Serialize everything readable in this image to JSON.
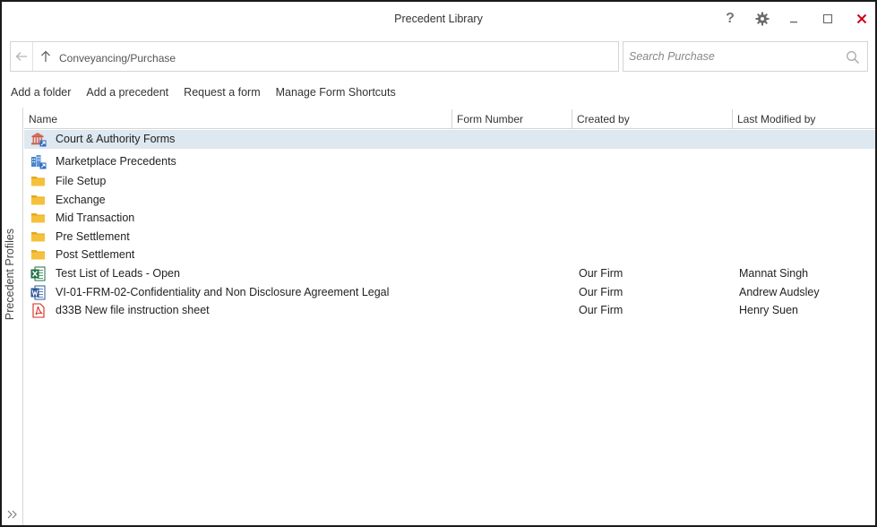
{
  "window": {
    "title": "Precedent Library"
  },
  "titlebar": {
    "help_label": "?"
  },
  "navigation": {
    "path": "Conveyancing/Purchase"
  },
  "search": {
    "placeholder": "Search Purchase"
  },
  "actions": [
    {
      "label": "Add a folder"
    },
    {
      "label": "Add a precedent"
    },
    {
      "label": "Request a form"
    },
    {
      "label": "Manage Form Shortcuts"
    }
  ],
  "sidebar": {
    "label": "Precedent Profiles"
  },
  "columns": {
    "name": "Name",
    "form_number": "Form Number",
    "created_by": "Created by",
    "last_modified_by": "Last Modified by"
  },
  "items": [
    {
      "name": "Court & Authority Forms",
      "icon": "court-building-shortcut-icon",
      "form_number": "",
      "created_by": "",
      "last_modified_by": "",
      "selected": true
    },
    {
      "name": "Marketplace Precedents",
      "icon": "marketplace-building-shortcut-icon",
      "form_number": "",
      "created_by": "",
      "last_modified_by": ""
    },
    {
      "name": "File Setup",
      "icon": "folder-icon",
      "form_number": "",
      "created_by": "",
      "last_modified_by": ""
    },
    {
      "name": "Exchange",
      "icon": "folder-icon",
      "form_number": "",
      "created_by": "",
      "last_modified_by": ""
    },
    {
      "name": "Mid Transaction",
      "icon": "folder-icon",
      "form_number": "",
      "created_by": "",
      "last_modified_by": ""
    },
    {
      "name": "Pre Settlement",
      "icon": "folder-icon",
      "form_number": "",
      "created_by": "",
      "last_modified_by": ""
    },
    {
      "name": "Post Settlement",
      "icon": "folder-icon",
      "form_number": "",
      "created_by": "",
      "last_modified_by": ""
    },
    {
      "name": "Test List of Leads - Open",
      "icon": "excel-file-icon",
      "form_number": "",
      "created_by": "Our Firm",
      "last_modified_by": "Mannat Singh"
    },
    {
      "name": "VI-01-FRM-02-Confidentiality and Non Disclosure Agreement Legal",
      "icon": "word-file-icon",
      "form_number": "",
      "created_by": "Our Firm",
      "last_modified_by": "Andrew Audsley"
    },
    {
      "name": "d33B New file instruction sheet",
      "icon": "pdf-file-icon",
      "form_number": "",
      "created_by": "Our Firm",
      "last_modified_by": "Henry Suen"
    }
  ],
  "colors": {
    "selected_row": "#dde8f0",
    "close_button": "#d0021b",
    "folder": "#f5c13c",
    "excel": "#1e7145",
    "word": "#2b579a",
    "pdf": "#d9261c"
  }
}
